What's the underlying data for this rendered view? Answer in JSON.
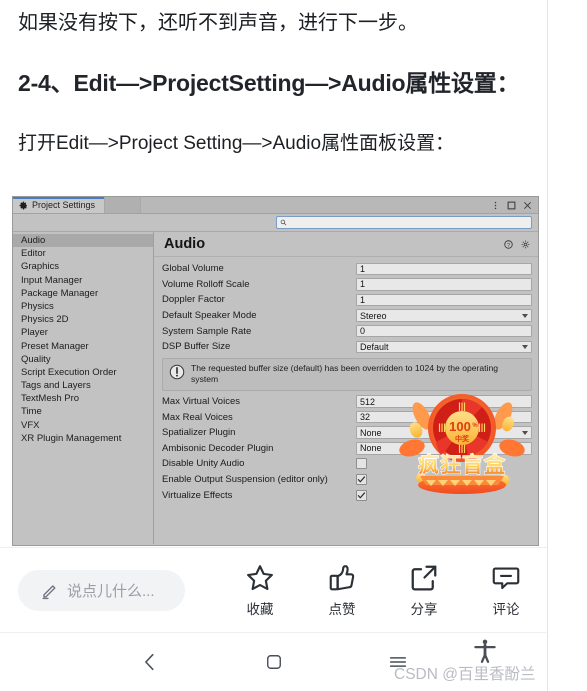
{
  "article": {
    "paragraph_top": "如果没有按下，还听不到声音，进行下一步。",
    "heading": "2-4、Edit—>ProjectSetting—>Audio属性设置：",
    "paragraph_two": "打开Edit—>Project Setting—>Audio属性面板设置："
  },
  "unity_window": {
    "tab_label": "Project Settings",
    "search": {
      "value": "",
      "placeholder": ""
    },
    "sidebar": {
      "selected": "Audio",
      "items": [
        "Audio",
        "Editor",
        "Graphics",
        "Input Manager",
        "Package Manager",
        "Physics",
        "Physics 2D",
        "Player",
        "Preset Manager",
        "Quality",
        "Script Execution Order",
        "Tags and Layers",
        "TextMesh Pro",
        "Time",
        "VFX",
        "XR Plugin Management"
      ]
    },
    "content": {
      "title": "Audio",
      "properties": [
        {
          "label": "Global Volume",
          "value": "1",
          "type": "text"
        },
        {
          "label": "Volume Rolloff Scale",
          "value": "1",
          "type": "text"
        },
        {
          "label": "Doppler Factor",
          "value": "1",
          "type": "text"
        },
        {
          "label": "Default Speaker Mode",
          "value": "Stereo",
          "type": "dropdown"
        },
        {
          "label": "System Sample Rate",
          "value": "0",
          "type": "text"
        },
        {
          "label": "DSP Buffer Size",
          "value": "Default",
          "type": "dropdown"
        }
      ],
      "notice": "The requested buffer size (default) has been overridden to 1024 by the operating system",
      "properties_lower": [
        {
          "label": "Max Virtual Voices",
          "value": "512",
          "type": "text"
        },
        {
          "label": "Max Real Voices",
          "value": "32",
          "type": "text"
        },
        {
          "label": "Spatializer Plugin",
          "value": "None",
          "type": "dropdown"
        },
        {
          "label": "Ambisonic Decoder Plugin",
          "value": "None",
          "type": "text"
        },
        {
          "label": "Disable Unity Audio",
          "value": "",
          "type": "checkbox",
          "checked": false
        },
        {
          "label": "Enable Output Suspension (editor only)",
          "value": "",
          "type": "checkbox",
          "checked": true
        },
        {
          "label": "Virtualize Effects",
          "value": "",
          "type": "checkbox",
          "checked": true
        }
      ]
    }
  },
  "promo": {
    "percent": "100",
    "percent_suffix": "%",
    "sub": "中奖",
    "title": "疯狂盲盒",
    "color_primary": "#f05a28",
    "color_secondary": "#fbb03b"
  },
  "action_bar": {
    "comment_placeholder": "说点儿什么...",
    "actions": [
      {
        "label": "收藏",
        "icon": "star-icon"
      },
      {
        "label": "点赞",
        "icon": "thumbs-up-icon"
      },
      {
        "label": "分享",
        "icon": "share-icon"
      },
      {
        "label": "评论",
        "icon": "comment-icon"
      }
    ]
  },
  "nav_bar": {
    "buttons": [
      {
        "name": "back-button",
        "icon": "chevron-left-icon"
      },
      {
        "name": "home-button",
        "icon": "square-icon"
      },
      {
        "name": "recents-button",
        "icon": "menu-icon"
      }
    ]
  },
  "watermark": "CSDN @百里香酚兰"
}
